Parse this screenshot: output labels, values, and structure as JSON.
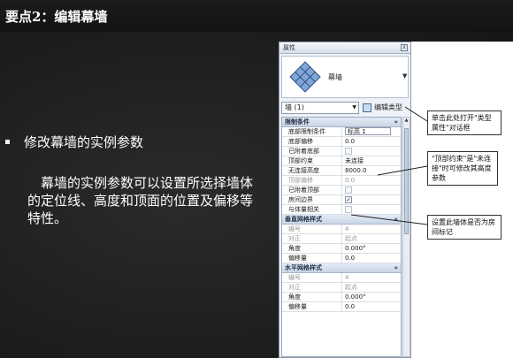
{
  "slide": {
    "title": "要点2：编辑幕墙",
    "bullet": "修改幕墙的实例参数",
    "body": "幕墙的实例参数可以设置所选择墙体的定位线、高度和顶面的位置及偏移等特性。"
  },
  "properties_panel": {
    "title": "属性",
    "close_label": "x",
    "type_name": "幕墙",
    "selector_value": "墙 (1)",
    "edit_type_label": "编辑类型",
    "groups": [
      {
        "name": "限制条件",
        "collapse": "«",
        "rows": [
          {
            "label": "底部限制条件",
            "value": "标高 1",
            "kind": "box"
          },
          {
            "label": "底部偏移",
            "value": "0.0",
            "kind": "text"
          },
          {
            "label": "已附着底部",
            "value": "",
            "kind": "check-gray"
          },
          {
            "label": "顶部约束",
            "value": "未连接",
            "kind": "text"
          },
          {
            "label": "无连接高度",
            "value": "8000.0",
            "kind": "text"
          },
          {
            "label": "顶部偏移",
            "value": "0.0",
            "kind": "gray"
          },
          {
            "label": "已附着顶部",
            "value": "",
            "kind": "check-gray"
          },
          {
            "label": "房间边界",
            "value": "✓",
            "kind": "check"
          },
          {
            "label": "与体量相关",
            "value": "",
            "kind": "check-gray"
          }
        ]
      },
      {
        "name": "垂直网格样式",
        "collapse": "«",
        "rows": [
          {
            "label": "编号",
            "value": "4",
            "kind": "gray"
          },
          {
            "label": "对正",
            "value": "起点",
            "kind": "gray"
          },
          {
            "label": "角度",
            "value": "0.000°",
            "kind": "text"
          },
          {
            "label": "偏移量",
            "value": "0.0",
            "kind": "text"
          }
        ]
      },
      {
        "name": "水平网格样式",
        "collapse": "«",
        "rows": [
          {
            "label": "编号",
            "value": "4",
            "kind": "gray"
          },
          {
            "label": "对正",
            "value": "起点",
            "kind": "gray"
          },
          {
            "label": "角度",
            "value": "0.000°",
            "kind": "text"
          },
          {
            "label": "偏移量",
            "value": "0.0",
            "kind": "text"
          }
        ]
      }
    ]
  },
  "callouts": {
    "edit_type": "单击此处打开\"类型属性\"对话框",
    "top_constraint": "\"顶部约束\"是\"未连接\"时可修改其高度参数",
    "room_bounding": "设置此墙体是否为房间标记"
  }
}
